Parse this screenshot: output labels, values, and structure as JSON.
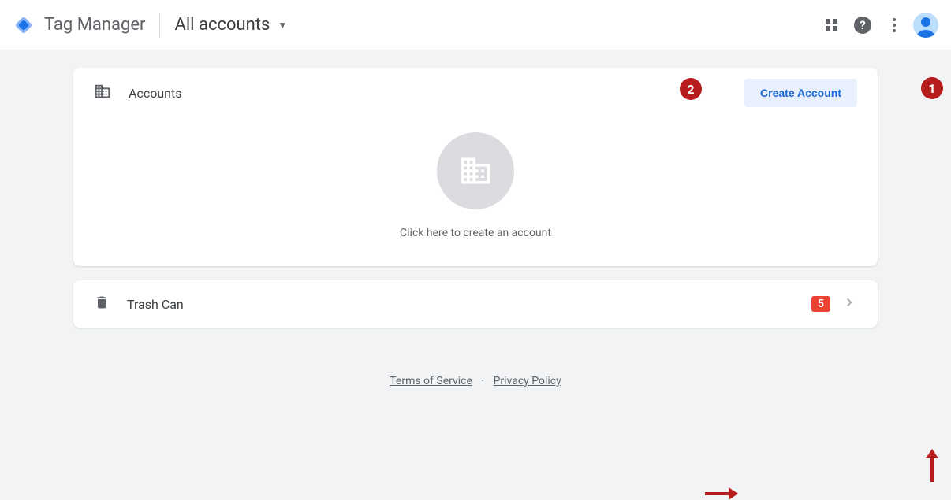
{
  "header": {
    "app_title": "Tag Manager",
    "scope_label": "All accounts"
  },
  "accounts_card": {
    "title": "Accounts",
    "create_button": "Create Account",
    "empty_text": "Click here to create an account"
  },
  "trash_card": {
    "title": "Trash Can",
    "badge_count": "5"
  },
  "footer": {
    "tos": "Terms of Service",
    "privacy": "Privacy Policy"
  },
  "annotations": {
    "step1": "1",
    "step2": "2"
  }
}
